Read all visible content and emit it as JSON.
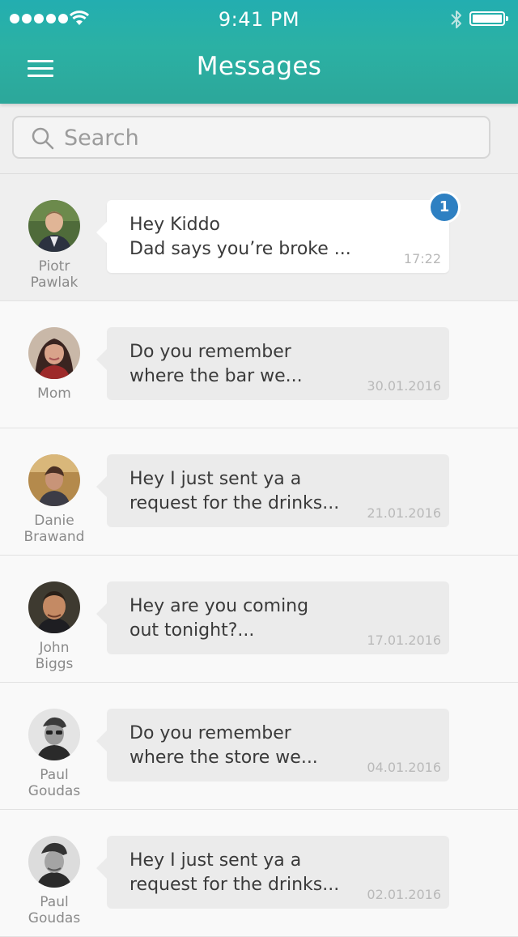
{
  "status_bar": {
    "time": "9:41 PM",
    "signal_icon": "cellular-signal-icon",
    "wifi_icon": "wifi-icon",
    "bluetooth_icon": "bluetooth-icon",
    "battery_icon": "battery-icon"
  },
  "header": {
    "title": "Messages",
    "menu_icon": "hamburger-menu-icon",
    "background_color": "#2bb0a6"
  },
  "search": {
    "placeholder": "Search",
    "icon": "search-icon"
  },
  "conversations": [
    {
      "name_line1": "Piotr",
      "name_line2": "Pawlak",
      "message_line1": "Hey Kiddo",
      "message_line2": "Dad says you’re broke ...",
      "time": "17:22",
      "unread_count": "1",
      "badge_color": "#2e80c2"
    },
    {
      "name_line1": "Mom",
      "name_line2": "",
      "message_line1": "Do you remember",
      "message_line2": "where the bar we...",
      "time": "30.01.2016"
    },
    {
      "name_line1": "Danie",
      "name_line2": "Brawand",
      "message_line1": "Hey I just sent ya a",
      "message_line2": "request for the drinks...",
      "time": "21.01.2016"
    },
    {
      "name_line1": "John",
      "name_line2": "Biggs",
      "message_line1": "Hey are you coming",
      "message_line2": "out tonight?...",
      "time": "17.01.2016"
    },
    {
      "name_line1": "Paul",
      "name_line2": "Goudas",
      "message_line1": "Do you remember",
      "message_line2": "where the store we...",
      "time": "04.01.2016"
    },
    {
      "name_line1": "Paul",
      "name_line2": "Goudas",
      "message_line1": "Hey I just sent ya a",
      "message_line2": "request for the drinks...",
      "time": "02.01.2016"
    }
  ]
}
